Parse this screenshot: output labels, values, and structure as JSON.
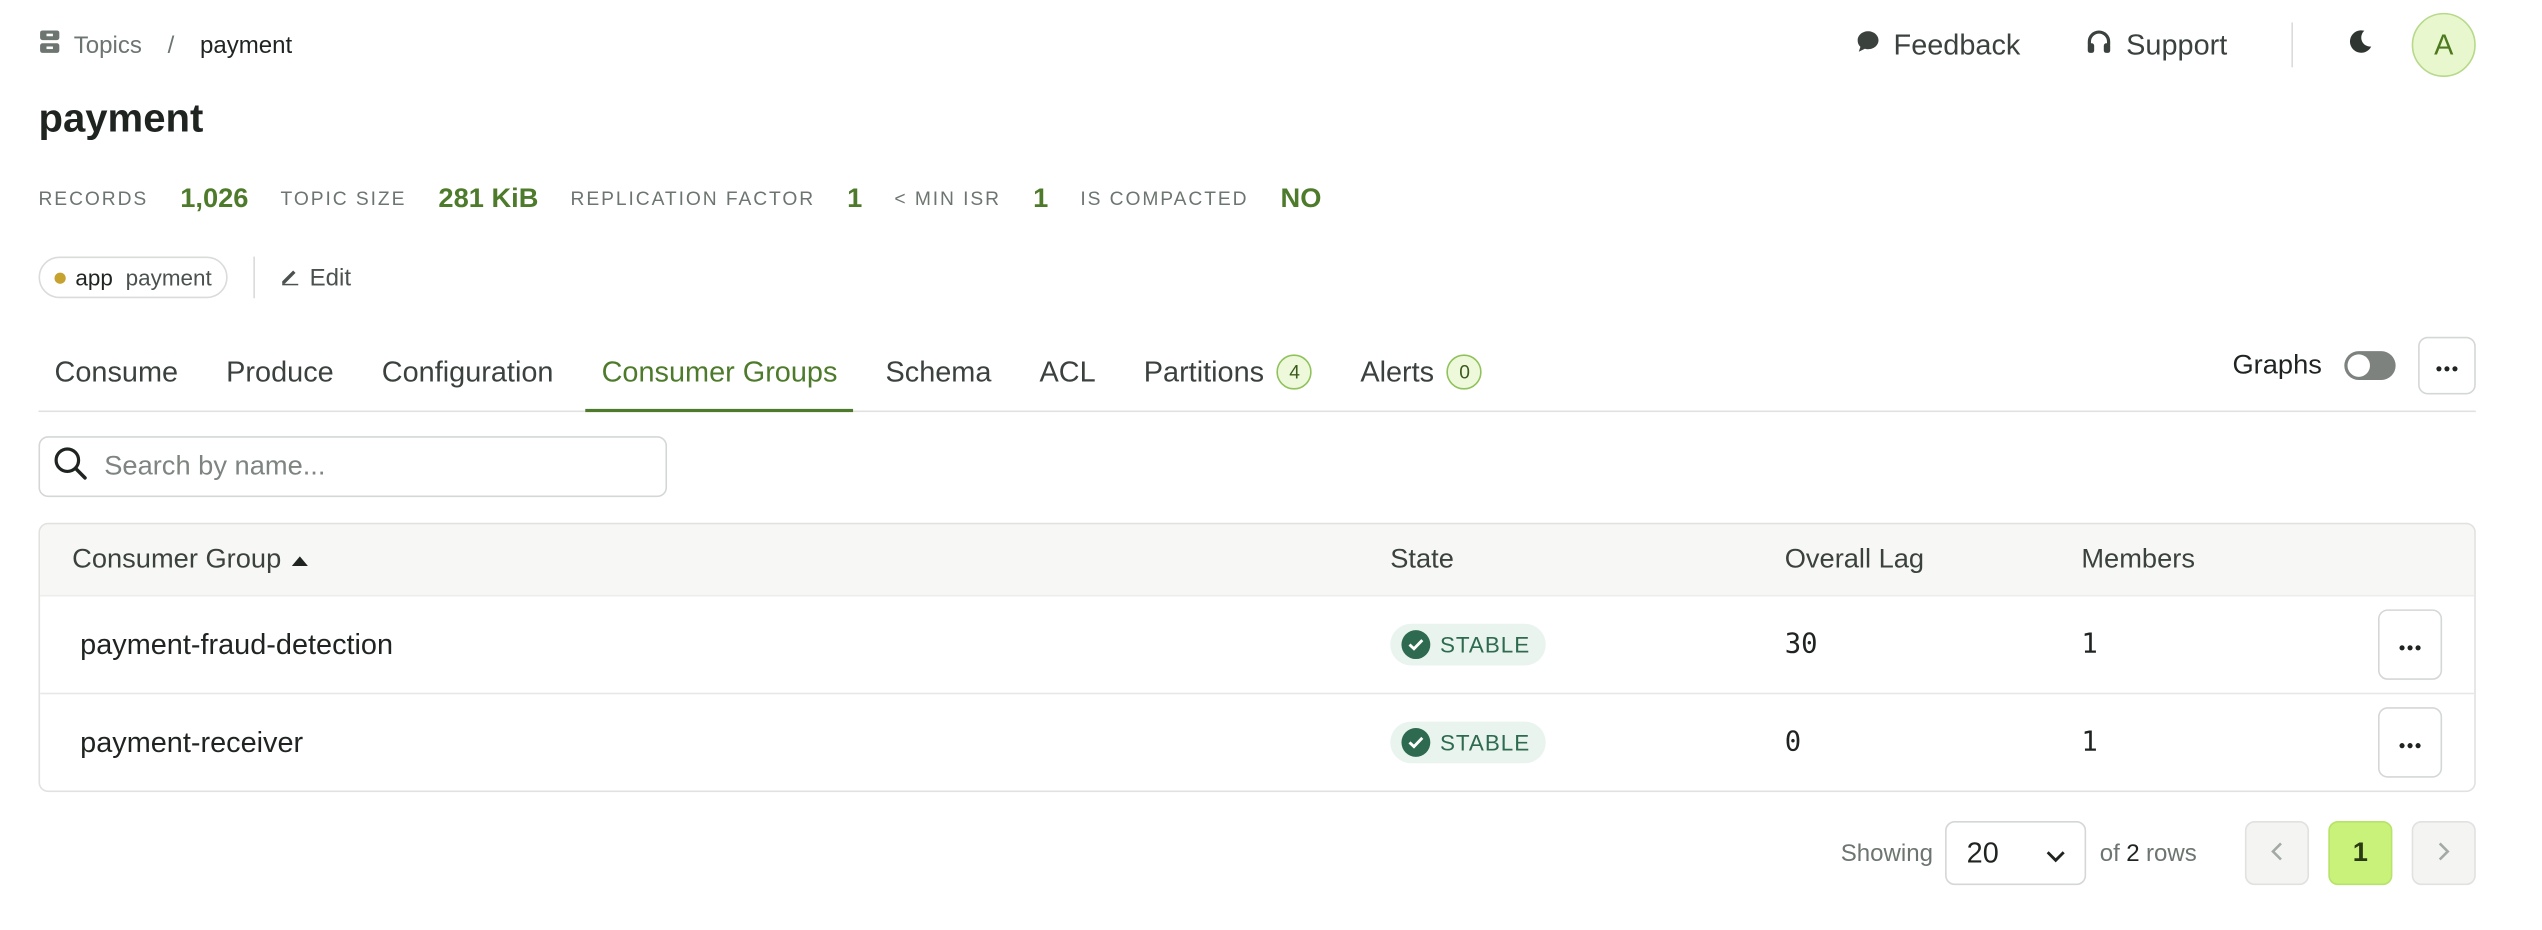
{
  "breadcrumb": {
    "parent": "Topics",
    "separator": "/",
    "current": "payment"
  },
  "top_actions": {
    "feedback": "Feedback",
    "support": "Support",
    "avatar_initial": "A"
  },
  "page": {
    "title": "payment"
  },
  "stats": [
    {
      "label": "RECORDS",
      "value": "1,026"
    },
    {
      "label": "TOPIC SIZE",
      "value": "281 KiB"
    },
    {
      "label": "REPLICATION FACTOR",
      "value": "1"
    },
    {
      "label": "< MIN ISR",
      "value": "1"
    },
    {
      "label": "IS COMPACTED",
      "value": "NO"
    }
  ],
  "tag": {
    "key": "app",
    "value": "payment",
    "edit_label": "Edit"
  },
  "tabs": [
    {
      "label": "Consume"
    },
    {
      "label": "Produce"
    },
    {
      "label": "Configuration"
    },
    {
      "label": "Consumer Groups",
      "active": true
    },
    {
      "label": "Schema"
    },
    {
      "label": "ACL"
    },
    {
      "label": "Partitions",
      "badge": "4"
    },
    {
      "label": "Alerts",
      "badge": "0"
    }
  ],
  "graphs": {
    "label": "Graphs",
    "enabled": false
  },
  "search": {
    "placeholder": "Search by name..."
  },
  "table": {
    "headers": {
      "name": "Consumer Group",
      "state": "State",
      "lag": "Overall Lag",
      "members": "Members"
    },
    "rows": [
      {
        "name": "payment-fraud-detection",
        "state": "STABLE",
        "lag": "30",
        "members": "1"
      },
      {
        "name": "payment-receiver",
        "state": "STABLE",
        "lag": "0",
        "members": "1"
      }
    ]
  },
  "pagination": {
    "showing": "Showing",
    "page_size": "20",
    "of": "of",
    "total": "2",
    "rows_label": "rows",
    "current_page": "1"
  },
  "colors": {
    "accent": "#4e7b2b",
    "stable": "#2d6a4f",
    "current_page": "#c8f27a"
  }
}
